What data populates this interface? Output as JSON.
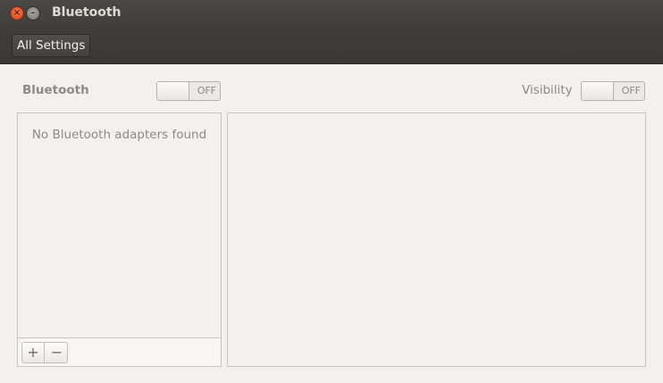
{
  "window": {
    "title": "Bluetooth"
  },
  "titlebar": {
    "close_icon": "close-icon",
    "minimize_icon": "minimize-icon",
    "close_glyph": "×",
    "minimize_glyph": "–"
  },
  "toolbar": {
    "all_settings_label": "All Settings"
  },
  "bluetooth": {
    "label": "Bluetooth",
    "switch_state": "OFF"
  },
  "visibility": {
    "label": "Visibility",
    "switch_state": "OFF"
  },
  "adapters": {
    "empty_message": "No Bluetooth adapters found",
    "add_glyph": "+",
    "remove_glyph": "−"
  },
  "colors": {
    "header_bg": "#3f3e3a",
    "close_button": "#e0542a",
    "window_bg": "#f2f1f0"
  }
}
